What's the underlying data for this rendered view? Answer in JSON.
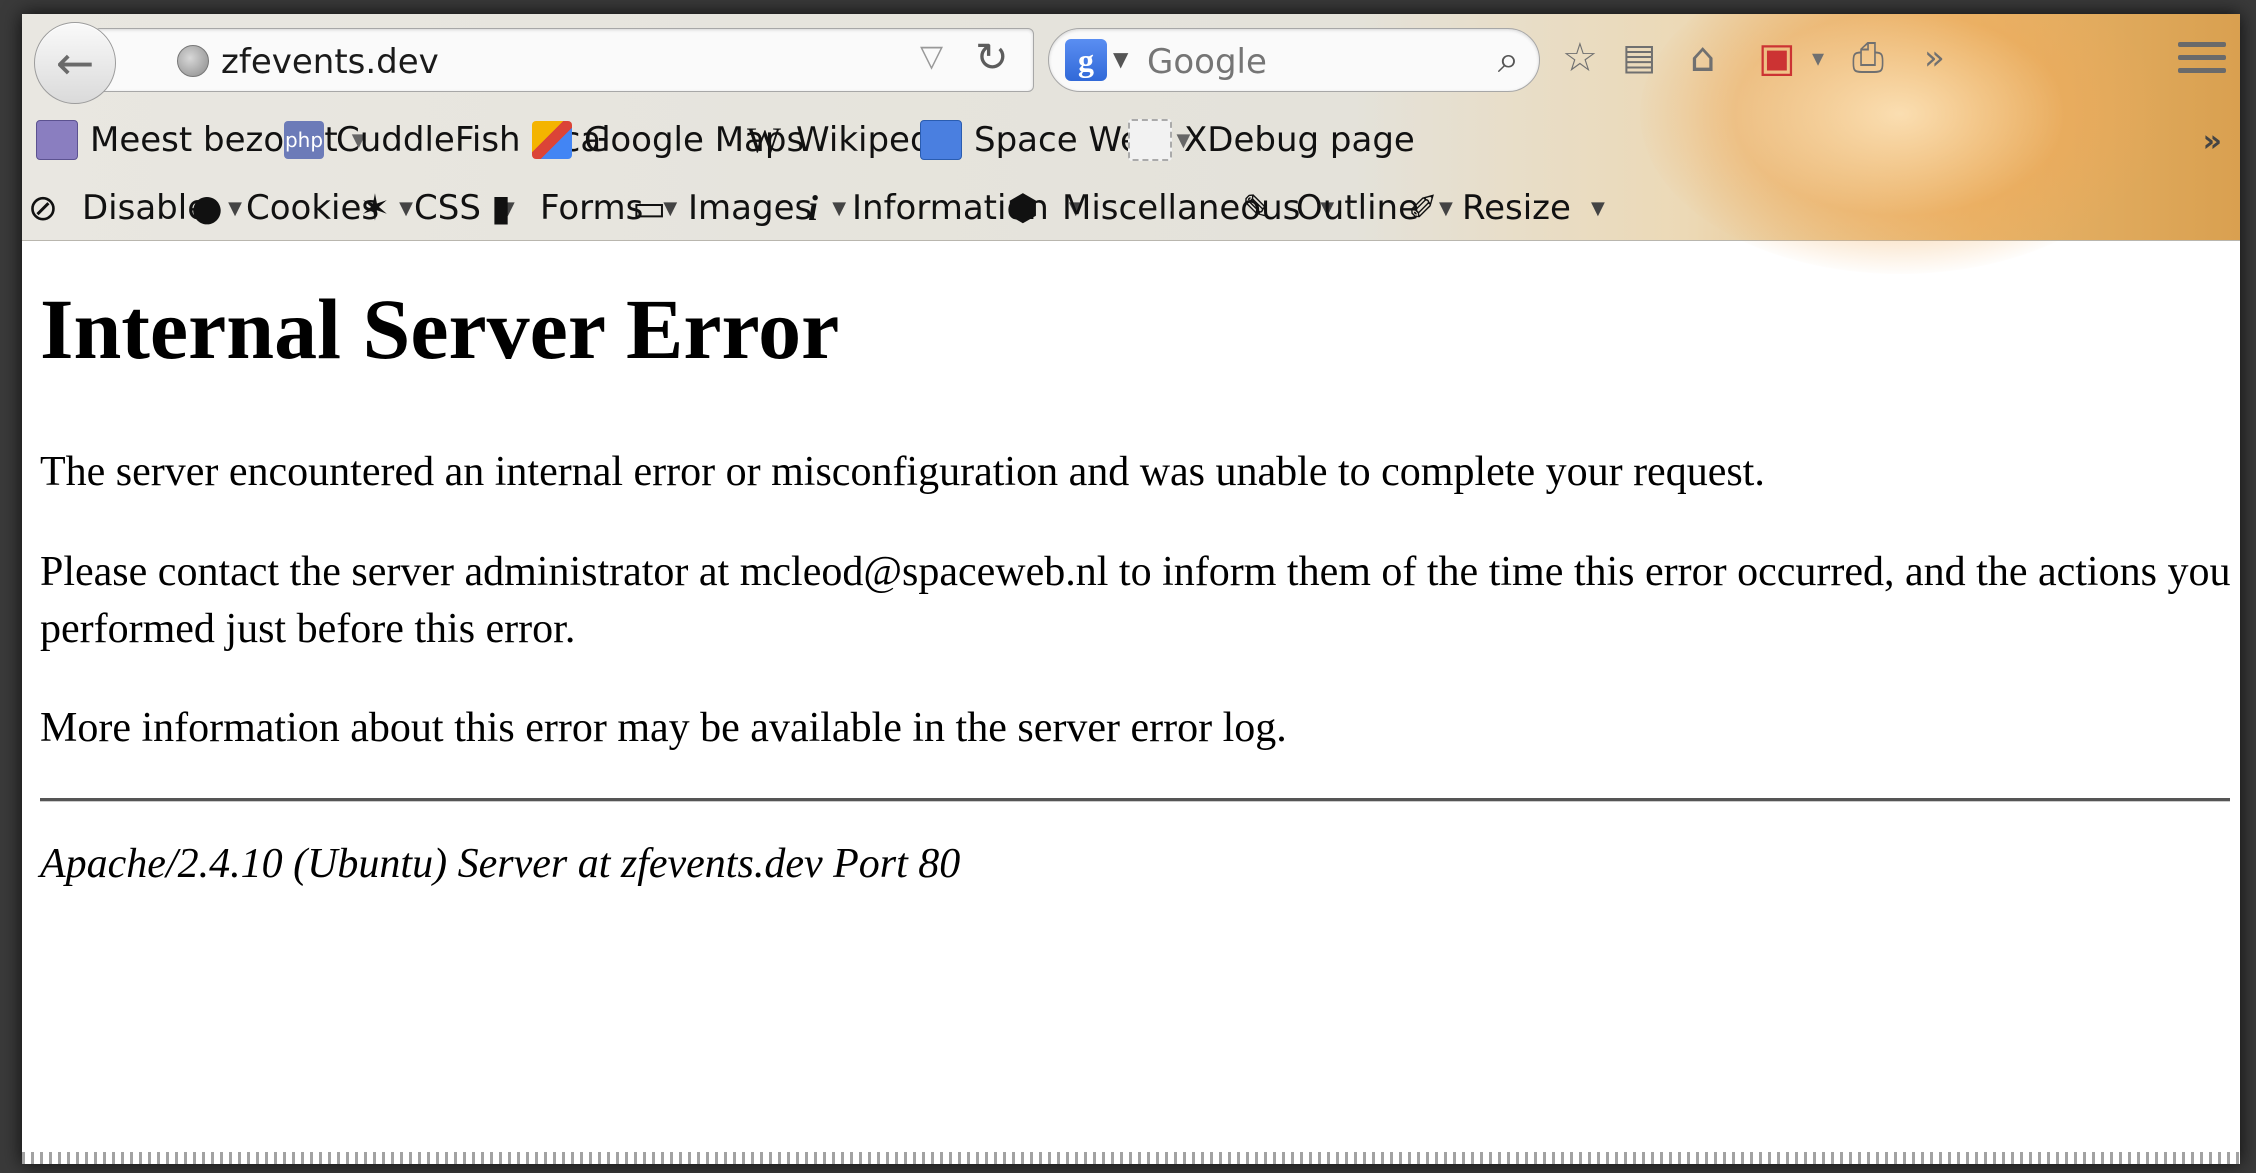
{
  "browser": {
    "url": "zfevents.dev",
    "search_engine": "Google",
    "search_placeholder": "Google"
  },
  "bookmarks": [
    {
      "label": "Meest bezocht",
      "icon": "star-folder-icon",
      "dropdown": true
    },
    {
      "label": "CuddleFish local",
      "icon": "php-icon",
      "dropdown": false
    },
    {
      "label": "Google Maps",
      "icon": "maps-pin-icon",
      "dropdown": false
    },
    {
      "label": "Wikipedia",
      "icon": "wikipedia-icon",
      "dropdown": false
    },
    {
      "label": "Space Web",
      "icon": "rss-folder-icon",
      "dropdown": true
    },
    {
      "label": "XDebug page",
      "icon": "blank-page-icon",
      "dropdown": false
    }
  ],
  "webdev_toolbar": [
    {
      "label": "Disable",
      "icon": "disable-icon"
    },
    {
      "label": "Cookies",
      "icon": "user-icon"
    },
    {
      "label": "CSS",
      "icon": "magic-wand-icon"
    },
    {
      "label": "Forms",
      "icon": "clipboard-icon"
    },
    {
      "label": "Images",
      "icon": "image-icon"
    },
    {
      "label": "Information",
      "icon": "info-icon"
    },
    {
      "label": "Miscellaneous",
      "icon": "cube-icon"
    },
    {
      "label": "Outline",
      "icon": "pencil-icon"
    },
    {
      "label": "Resize",
      "icon": "ruler-icon"
    }
  ],
  "page": {
    "title": "Internal Server Error",
    "paragraph1": "The server encountered an internal error or misconfiguration and was unable to complete your request.",
    "paragraph2": "Please contact the server administrator at mcleod@spaceweb.nl to inform them of the time this error occurred, and the actions you performed just before this error.",
    "paragraph3": "More information about this error may be available in the server error log.",
    "server_signature": "Apache/2.4.10 (Ubuntu) Server at zfevents.dev Port 80"
  }
}
